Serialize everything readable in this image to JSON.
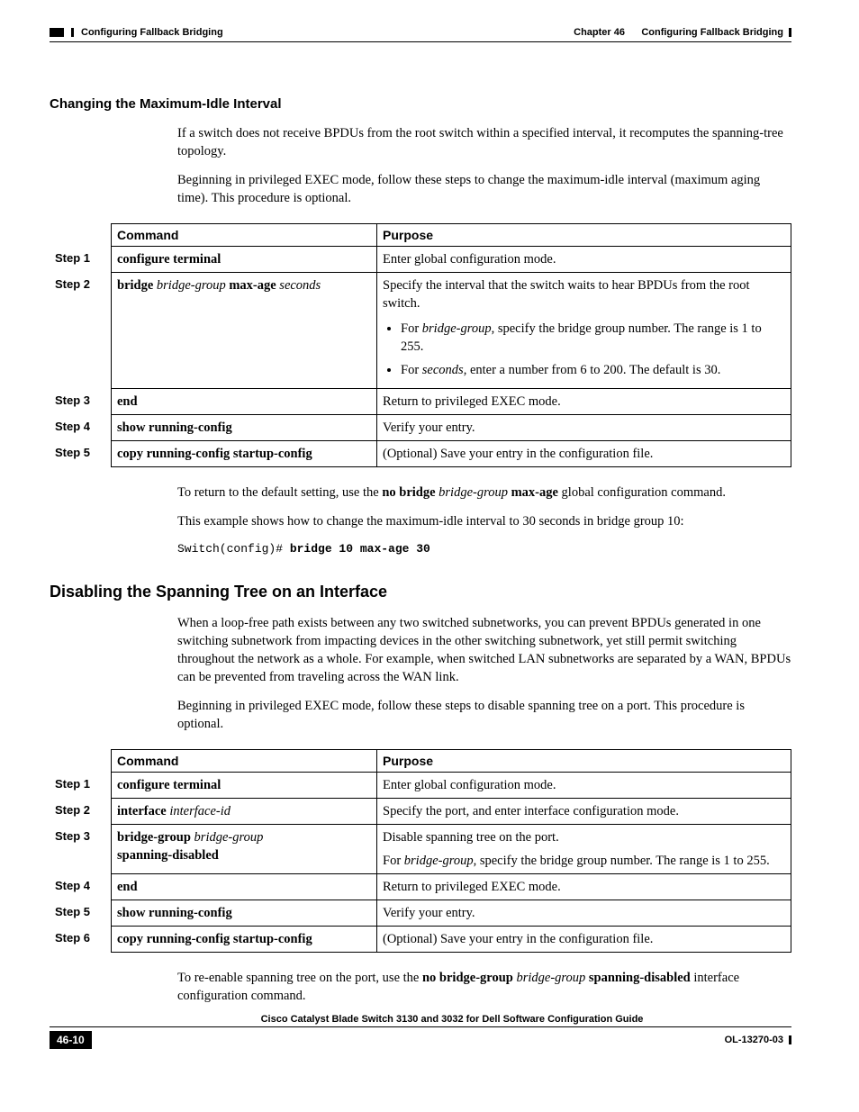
{
  "header": {
    "running_left": "Configuring Fallback Bridging",
    "chapter_line": "Chapter 46      Configuring Fallback Bridging"
  },
  "sec1": {
    "heading": "Changing the Maximum-Idle Interval",
    "p1": "If a switch does not receive BPDUs from the root switch within a specified interval, it recomputes the spanning-tree topology.",
    "p2": "Beginning in privileged EXEC mode, follow these steps to change the maximum-idle interval (maximum aging time). This procedure is optional."
  },
  "table_headers": {
    "command": "Command",
    "purpose": "Purpose"
  },
  "table1": {
    "r1": {
      "step": "Step 1",
      "cmd_b1": "configure terminal",
      "purp": "Enter global configuration mode."
    },
    "r2": {
      "step": "Step 2",
      "cmd_b1": "bridge ",
      "cmd_i1": "bridge-group",
      "cmd_b2": " max-age ",
      "cmd_i2": "seconds",
      "purp_p1": "Specify the interval that the switch waits to hear BPDUs from the root switch.",
      "b1_pre": "For ",
      "b1_it": "bridge-group",
      "b1_post": ", specify the bridge group number. The range is 1 to 255.",
      "b2_pre": "For ",
      "b2_it": "seconds",
      "b2_post": ", enter a number from 6 to 200. The default is 30."
    },
    "r3": {
      "step": "Step 3",
      "cmd_b1": "end",
      "purp": "Return to privileged EXEC mode."
    },
    "r4": {
      "step": "Step 4",
      "cmd_b1": "show running-config",
      "purp": "Verify your entry."
    },
    "r5": {
      "step": "Step 5",
      "cmd_b1": "copy running-config startup-config",
      "purp": "(Optional) Save your entry in the configuration file."
    }
  },
  "after1": {
    "p1_a": "To return to the default setting, use the ",
    "p1_b": "no bridge ",
    "p1_i": "bridge-group",
    "p1_c": " max-age",
    "p1_d": " global configuration command.",
    "p2": "This example shows how to change the maximum-idle interval to 30 seconds in bridge group 10:",
    "code_plain": "Switch(config)# ",
    "code_bold": "bridge 10 max-age 30"
  },
  "sec2": {
    "heading": "Disabling the Spanning Tree on an Interface",
    "p1": "When a loop-free path exists between any two switched subnetworks, you can prevent BPDUs generated in one switching subnetwork from impacting devices in the other switching subnetwork, yet still permit switching throughout the network as a whole. For example, when switched LAN subnetworks are separated by a WAN, BPDUs can be prevented from traveling across the WAN link.",
    "p2": "Beginning in privileged EXEC mode, follow these steps to disable spanning tree on a port. This procedure is optional."
  },
  "table2": {
    "r1": {
      "step": "Step 1",
      "cmd_b1": "configure terminal",
      "purp": "Enter global configuration mode."
    },
    "r2": {
      "step": "Step 2",
      "cmd_b1": "interface ",
      "cmd_i1": "interface-id",
      "purp": "Specify the port, and enter interface configuration mode."
    },
    "r3": {
      "step": "Step 3",
      "cmd_b1": "bridge-group ",
      "cmd_i1": "bridge-group",
      "cmd_b2": " spanning-disabled",
      "purp_p1": "Disable spanning tree on the port.",
      "purp_p2a": "For ",
      "purp_p2i": "bridge-group",
      "purp_p2b": ", specify the bridge group number. The range is 1 to 255."
    },
    "r4": {
      "step": "Step 4",
      "cmd_b1": "end",
      "purp": "Return to privileged EXEC mode."
    },
    "r5": {
      "step": "Step 5",
      "cmd_b1": "show running-config",
      "purp": "Verify your entry."
    },
    "r6": {
      "step": "Step 6",
      "cmd_b1": "copy running-config startup-config",
      "purp": "(Optional) Save your entry in the configuration file."
    }
  },
  "after2": {
    "p1_a": "To re-enable spanning tree on the port, use the ",
    "p1_b": "no bridge-group ",
    "p1_i": "bridge-group",
    "p1_c": " spanning-disabled",
    "p1_d": " interface configuration command."
  },
  "footer": {
    "book_title": "Cisco Catalyst Blade Switch 3130 and 3032 for Dell Software Configuration Guide",
    "page": "46-10",
    "doc_id": "OL-13270-03"
  }
}
